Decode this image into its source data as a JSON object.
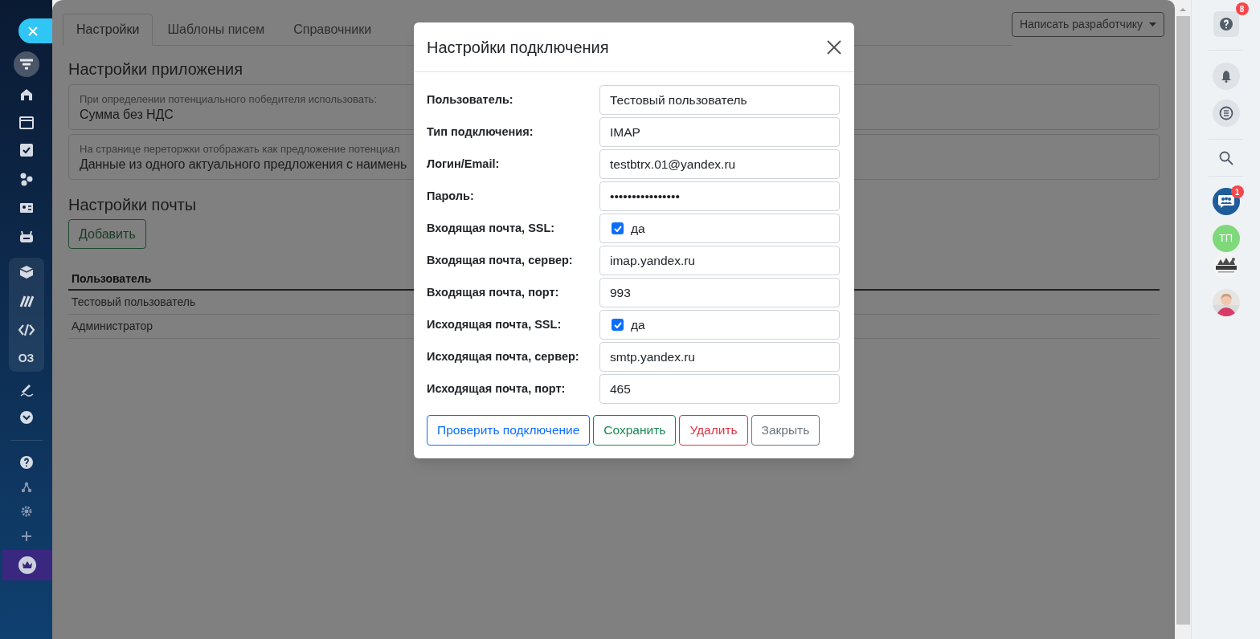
{
  "sidebar": {
    "project_badge": "ОЗ"
  },
  "tabs": [
    {
      "label": "Настройки",
      "selected": true
    },
    {
      "label": "Шаблоны писем",
      "selected": false
    },
    {
      "label": "Справочники",
      "selected": false
    }
  ],
  "developer_button": "Написать разработчику",
  "app_settings": {
    "title": "Настройки приложения",
    "fields": [
      {
        "label": "При определении потенциального победителя использовать:",
        "value": "Сумма без НДС"
      },
      {
        "label": "На странице переторжки отображать как предложение потенциал",
        "value": "Данные из одного актуального предложения с наимень"
      }
    ]
  },
  "mail_settings": {
    "title": "Настройки почты",
    "add_button": "Добавить",
    "table": {
      "columns": [
        "Пользователь"
      ],
      "rows": [
        [
          "Тестовый пользователь"
        ],
        [
          "Администратор"
        ]
      ]
    }
  },
  "modal": {
    "title": "Настройки подключения",
    "fields": [
      {
        "kind": "text",
        "label": "Пользователь:",
        "value": "Тестовый пользователь"
      },
      {
        "kind": "text",
        "label": "Тип подключения:",
        "value": "IMAP"
      },
      {
        "kind": "text",
        "label": "Логин/Email:",
        "value": "testbtrx.01@yandex.ru"
      },
      {
        "kind": "text",
        "label": "Пароль:",
        "value": "••••••••••••••••"
      },
      {
        "kind": "checkbox",
        "label": "Входящая почта, SSL:",
        "checked": true,
        "option": "да"
      },
      {
        "kind": "text",
        "label": "Входящая почта, сервер:",
        "value": "imap.yandex.ru"
      },
      {
        "kind": "text",
        "label": "Входящая почта, порт:",
        "value": "993"
      },
      {
        "kind": "checkbox",
        "label": "Исходящая почта, SSL:",
        "checked": true,
        "option": "да"
      },
      {
        "kind": "text",
        "label": "Исходящая почта, сервер:",
        "value": "smtp.yandex.ru"
      },
      {
        "kind": "text",
        "label": "Исходящая почта, порт:",
        "value": "465"
      }
    ],
    "buttons": [
      {
        "label": "Проверить подключение",
        "kind": "primary"
      },
      {
        "label": "Сохранить",
        "kind": "success"
      },
      {
        "label": "Удалить",
        "kind": "danger"
      },
      {
        "label": "Закрыть",
        "kind": "secondary"
      }
    ]
  },
  "right_panel": {
    "help_badge": "8",
    "chat_badge": "1",
    "avatar_initials": "ТП"
  }
}
